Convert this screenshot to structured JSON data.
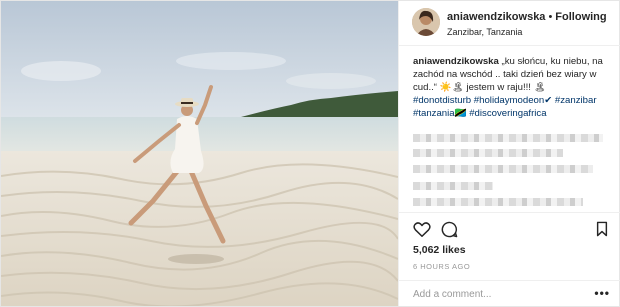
{
  "post": {
    "username": "aniawendzikowska",
    "separator": "•",
    "follow_status": "Following",
    "location": "Zanzibar, Tanzania",
    "caption": {
      "user": "aniawendzikowska",
      "text": " „ku słońcu, ku niebu, na zachód na wschód .. taki dzień bez wiary w cud..“ ☀️🏝 jestem w raju!!! 🏝",
      "hashtags": "#donotdisturb #holidaymodeon✔ #zanzibar #tanzania🇹🇿 #discoveringafrica"
    },
    "likes": "5,062 likes",
    "time": "6 HOURS AGO",
    "comment_placeholder": "Add a comment...",
    "more_label": "•••"
  },
  "icons": {
    "like": "heart-icon",
    "comment": "comment-icon",
    "save": "bookmark-icon"
  },
  "colors": {
    "text": "#262626",
    "muted": "#999999",
    "hashtag": "#003569",
    "border": "#efefef"
  }
}
